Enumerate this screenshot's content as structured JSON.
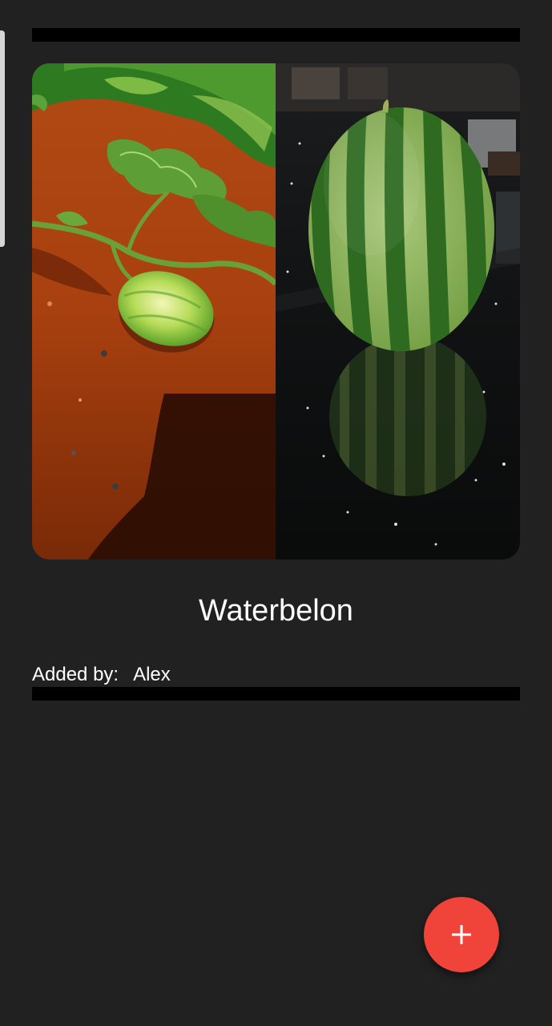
{
  "item": {
    "title": "Waterbelon",
    "added_by_label": "Added by:",
    "added_by_name": "Alex",
    "images": [
      {
        "icon": "watermelon-plant-photo"
      },
      {
        "icon": "watermelon-on-counter-photo"
      }
    ]
  },
  "fab": {
    "icon": "plus-icon"
  },
  "colors": {
    "background": "#212121",
    "divider": "#000000",
    "fab": "#f0433a",
    "text": "#ffffff"
  }
}
